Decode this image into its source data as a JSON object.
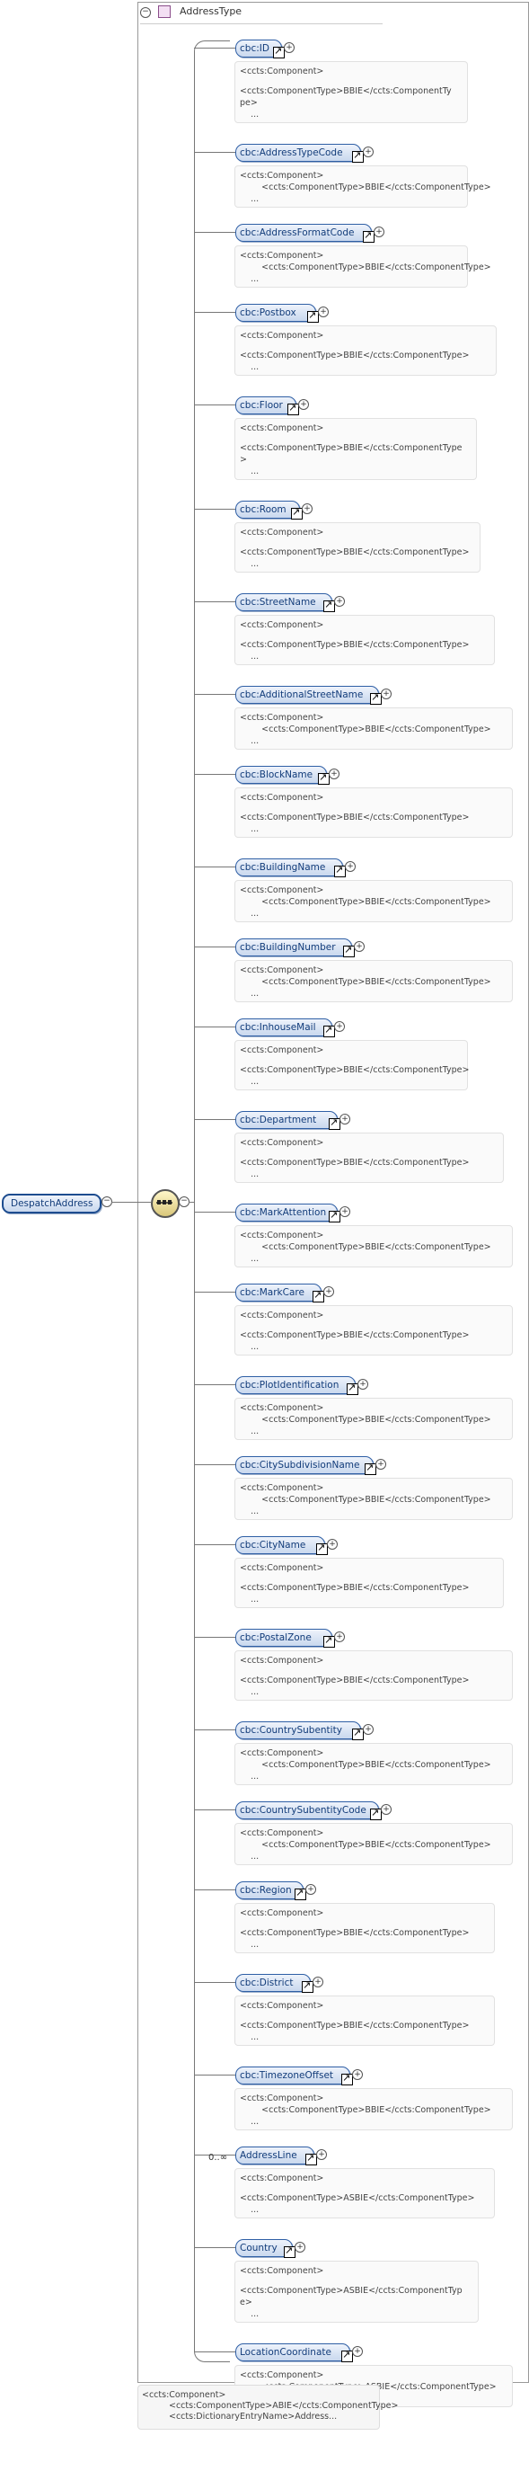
{
  "root": {
    "label": "DespatchAddress"
  },
  "type_box": {
    "label": "AddressType"
  },
  "sequence_multiplicity": "0..∞",
  "bottom_doc": {
    "line1": "<ccts:Component>",
    "line2": "<ccts:ComponentType>ABIE</ccts:ComponentType>",
    "line3": "<ccts:DictionaryEntryName>Address..."
  },
  "elements": [
    {
      "name": "cbc:ID",
      "doc": [
        "<ccts:Component>",
        "",
        "<ccts:ComponentType>BBIE</ccts:ComponentTy",
        "pe>",
        "    ..."
      ]
    },
    {
      "name": "cbc:AddressTypeCode",
      "doc": [
        "<ccts:Component>",
        "        <ccts:ComponentType>BBIE</ccts:ComponentType>",
        "    ..."
      ]
    },
    {
      "name": "cbc:AddressFormatCode",
      "doc": [
        "<ccts:Component>",
        "        <ccts:ComponentType>BBIE</ccts:ComponentType>",
        "    ..."
      ]
    },
    {
      "name": "cbc:Postbox",
      "doc": [
        "<ccts:Component>",
        "",
        "<ccts:ComponentType>BBIE</ccts:ComponentType>",
        "    ..."
      ]
    },
    {
      "name": "cbc:Floor",
      "doc": [
        "<ccts:Component>",
        "",
        "<ccts:ComponentType>BBIE</ccts:ComponentType",
        ">",
        "    ..."
      ]
    },
    {
      "name": "cbc:Room",
      "doc": [
        "<ccts:Component>",
        "",
        "<ccts:ComponentType>BBIE</ccts:ComponentType>",
        "    ..."
      ]
    },
    {
      "name": "cbc:StreetName",
      "doc": [
        "<ccts:Component>",
        "",
        "<ccts:ComponentType>BBIE</ccts:ComponentType>",
        "    ..."
      ]
    },
    {
      "name": "cbc:AdditionalStreetName",
      "doc": [
        "<ccts:Component>",
        "        <ccts:ComponentType>BBIE</ccts:ComponentType>",
        "    ..."
      ]
    },
    {
      "name": "cbc:BlockName",
      "doc": [
        "<ccts:Component>",
        "",
        "<ccts:ComponentType>BBIE</ccts:ComponentType>",
        "    ..."
      ]
    },
    {
      "name": "cbc:BuildingName",
      "doc": [
        "<ccts:Component>",
        "        <ccts:ComponentType>BBIE</ccts:ComponentType>",
        "    ..."
      ]
    },
    {
      "name": "cbc:BuildingNumber",
      "doc": [
        "<ccts:Component>",
        "        <ccts:ComponentType>BBIE</ccts:ComponentType>",
        "    ..."
      ]
    },
    {
      "name": "cbc:InhouseMail",
      "doc": [
        "<ccts:Component>",
        "",
        "<ccts:ComponentType>BBIE</ccts:ComponentType>",
        "    ..."
      ]
    },
    {
      "name": "cbc:Department",
      "doc": [
        "<ccts:Component>",
        "",
        "<ccts:ComponentType>BBIE</ccts:ComponentType>",
        "    ..."
      ]
    },
    {
      "name": "cbc:MarkAttention",
      "doc": [
        "<ccts:Component>",
        "        <ccts:ComponentType>BBIE</ccts:ComponentType>",
        "    ..."
      ]
    },
    {
      "name": "cbc:MarkCare",
      "doc": [
        "<ccts:Component>",
        "",
        "<ccts:ComponentType>BBIE</ccts:ComponentType>",
        "    ..."
      ]
    },
    {
      "name": "cbc:PlotIdentification",
      "doc": [
        "<ccts:Component>",
        "        <ccts:ComponentType>BBIE</ccts:ComponentType>",
        "    ..."
      ]
    },
    {
      "name": "cbc:CitySubdivisionName",
      "doc": [
        "<ccts:Component>",
        "        <ccts:ComponentType>BBIE</ccts:ComponentType>",
        "    ..."
      ]
    },
    {
      "name": "cbc:CityName",
      "doc": [
        "<ccts:Component>",
        "",
        "<ccts:ComponentType>BBIE</ccts:ComponentType>",
        "    ..."
      ]
    },
    {
      "name": "cbc:PostalZone",
      "doc": [
        "<ccts:Component>",
        "",
        "<ccts:ComponentType>BBIE</ccts:ComponentType>",
        "    ..."
      ]
    },
    {
      "name": "cbc:CountrySubentity",
      "doc": [
        "<ccts:Component>",
        "        <ccts:ComponentType>BBIE</ccts:ComponentType>",
        "    ..."
      ]
    },
    {
      "name": "cbc:CountrySubentityCode",
      "doc": [
        "<ccts:Component>",
        "        <ccts:ComponentType>BBIE</ccts:ComponentType>",
        "    ..."
      ]
    },
    {
      "name": "cbc:Region",
      "doc": [
        "<ccts:Component>",
        "",
        "<ccts:ComponentType>BBIE</ccts:ComponentType>",
        "    ..."
      ]
    },
    {
      "name": "cbc:District",
      "doc": [
        "<ccts:Component>",
        "",
        "<ccts:ComponentType>BBIE</ccts:ComponentType>",
        "    ..."
      ]
    },
    {
      "name": "cbc:TimezoneOffset",
      "doc": [
        "<ccts:Component>",
        "        <ccts:ComponentType>BBIE</ccts:ComponentType>",
        "    ..."
      ]
    },
    {
      "name": "AddressLine",
      "doc": [
        "<ccts:Component>",
        "",
        "<ccts:ComponentType>ASBIE</ccts:ComponentType>",
        "    ..."
      ]
    },
    {
      "name": "Country",
      "doc": [
        "<ccts:Component>",
        "",
        "<ccts:ComponentType>ASBIE</ccts:ComponentTyp",
        "e>",
        "    ..."
      ]
    },
    {
      "name": "LocationCoordinate",
      "doc": [
        "<ccts:Component>",
        "        <ccts:ComponentType>ASBIE</ccts:ComponentType>",
        "    ..."
      ]
    }
  ]
}
